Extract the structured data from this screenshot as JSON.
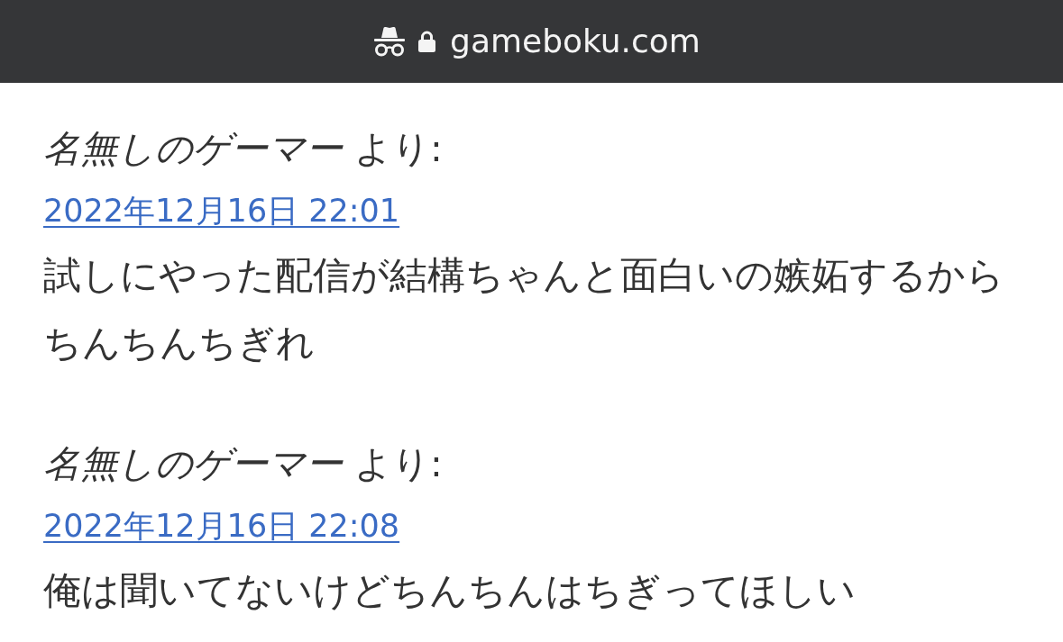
{
  "address_bar": {
    "url": "gameboku.com"
  },
  "comments": [
    {
      "byline": "*名無しのゲーマー* より:",
      "date": "2022年12月16日 22:01",
      "body": "試しにやった配信が結構ちゃんと面白いの嫉妬するからちんちんちぎれ"
    },
    {
      "byline": "*名無しのゲーマー* より:",
      "date": "2022年12月16日 22:08",
      "body": "俺は聞いてないけどちんちんはちぎってほしい"
    }
  ]
}
